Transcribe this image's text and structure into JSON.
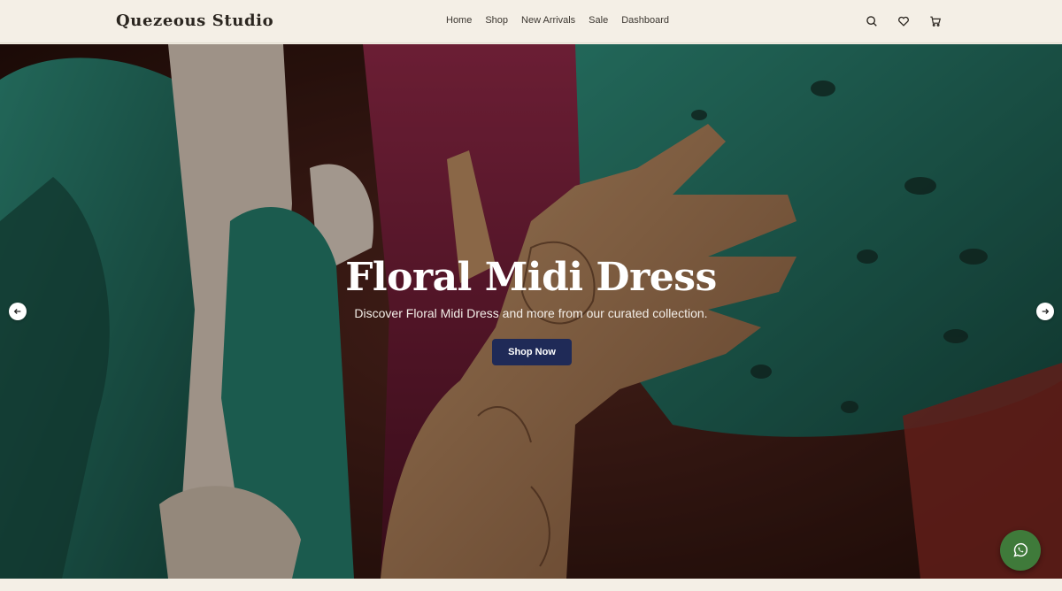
{
  "header": {
    "brand": "Quezeous Studio",
    "nav": [
      "Home",
      "Shop",
      "New Arrivals",
      "Sale",
      "Dashboard"
    ],
    "icons": [
      "search-icon",
      "heart-icon",
      "cart-icon"
    ]
  },
  "hero": {
    "title": "Floral Midi Dress",
    "subtitle": "Discover Floral Midi Dress and more from our curated collection.",
    "cta_label": "Shop Now",
    "prev_icon": "arrow-left-icon",
    "next_icon": "arrow-right-icon"
  },
  "floating": {
    "icon": "whatsapp-icon"
  },
  "colors": {
    "header_bg": "#f4efe6",
    "cta_bg": "#1f2a57",
    "whatsapp_bg": "#3f7a3a",
    "fabric_teal": "#1d7a6a",
    "fabric_magenta": "#7a1a3a"
  }
}
